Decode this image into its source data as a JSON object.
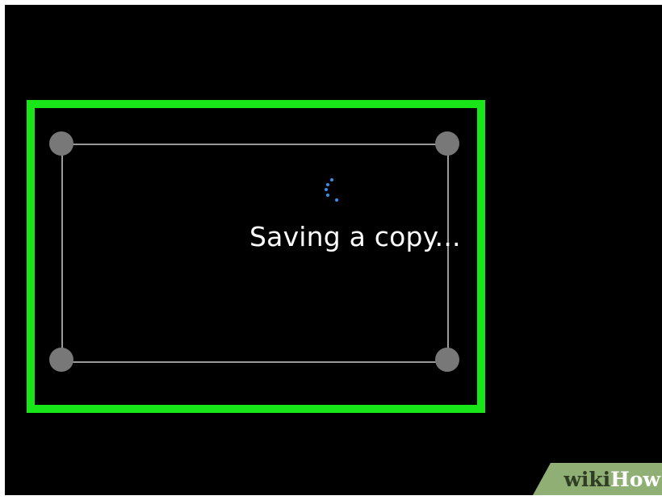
{
  "status": {
    "message": "Saving a copy...",
    "spinner_icon": "loading-spinner-icon",
    "spinner_color": "#3a8ee6"
  },
  "highlight": {
    "color": "#19e619"
  },
  "watermark": {
    "part1": "wiki",
    "part2": "How",
    "background": "#8faf74"
  }
}
